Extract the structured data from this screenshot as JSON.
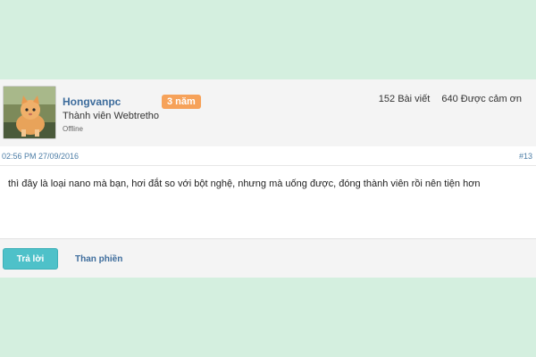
{
  "post": {
    "author": {
      "username": "Hongvanpc",
      "membership_badge": "3 năm",
      "user_title": "Thành viên Webtretho",
      "status": "Offline",
      "avatar": "cat-avatar"
    },
    "stats": {
      "posts": "152 Bài viết",
      "thanks": "640 Được cảm ơn"
    },
    "timestamp": "02:56 PM 27/09/2016",
    "post_number": "#13",
    "message": "thì đây là loại nano mà bạn, hơi đắt so với bột nghệ, nhưng mà uống được, đóng thành viên rồi nên tiện hơn",
    "actions": {
      "reply_label": "Trả lời",
      "report_label": "Than phiền"
    }
  },
  "colors": {
    "page_background": "#d4efdf",
    "badge": "#f6a25a",
    "reply_button": "#4ec1c9",
    "link": "#3d6c9c"
  }
}
